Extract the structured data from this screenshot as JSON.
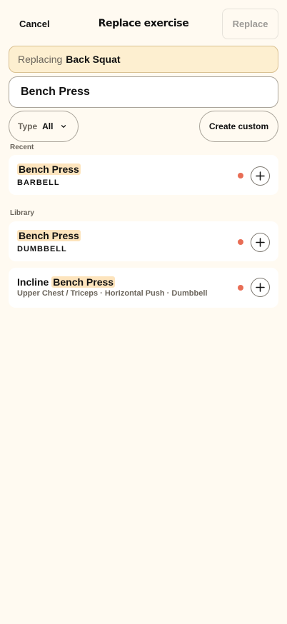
{
  "header": {
    "cancel_label": "Cancel",
    "title": "Replace exercise",
    "replace_label": "Replace"
  },
  "replacing": {
    "prefix": "Replacing",
    "exercise": "Back Squat"
  },
  "search": {
    "value": "Bench Press"
  },
  "filter": {
    "type_label": "Type",
    "type_value": "All"
  },
  "create_custom_label": "Create custom",
  "recent": {
    "label": "Recent",
    "items": [
      {
        "title_highlight": "Bench Press",
        "subtitle": "BARBELL"
      }
    ]
  },
  "library": {
    "label": "Library",
    "items": [
      {
        "title_highlight": "Bench Press",
        "subtitle": "DUMBBELL"
      },
      {
        "title_prefix": "Incline",
        "title_highlight": "Bench Press",
        "meta": "Upper Chest / Triceps · Horizontal Push · Dumbbell"
      }
    ]
  },
  "colors": {
    "background": "#fffaf1",
    "highlight": "#fde4bd",
    "status_dot": "#e86d55",
    "replacing_bg": "#fdefd0"
  }
}
